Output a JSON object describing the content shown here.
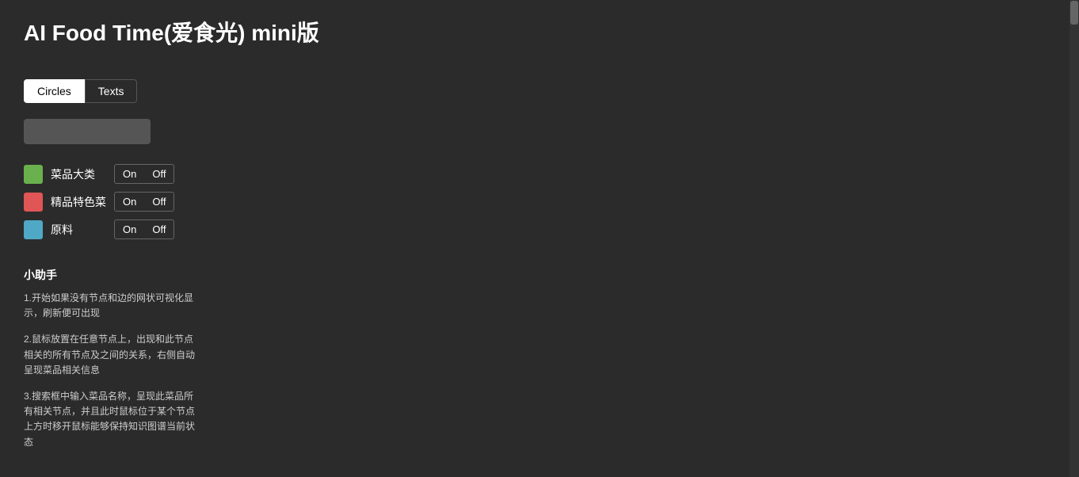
{
  "app": {
    "title": "AI Food Time(爱食光) mini版"
  },
  "tabs": [
    {
      "id": "circles",
      "label": "Circles",
      "active": true
    },
    {
      "id": "texts",
      "label": "Texts",
      "active": false
    }
  ],
  "search": {
    "placeholder": "",
    "value": ""
  },
  "legend": [
    {
      "id": "category",
      "label": "菜品大类",
      "color": "#6ab04c",
      "toggle": {
        "on": "On",
        "off": "Off",
        "state": "on"
      }
    },
    {
      "id": "featured",
      "label": "精品特色菜",
      "color": "#e05555",
      "toggle": {
        "on": "On",
        "off": "Off",
        "state": "on"
      }
    },
    {
      "id": "ingredient",
      "label": "原料",
      "color": "#4fa8c5",
      "toggle": {
        "on": "On",
        "off": "Off",
        "state": "on"
      }
    }
  ],
  "helper": {
    "title": "小助手",
    "items": [
      "1.开始如果没有节点和边的网状可视化显示，刷新便可出现",
      "2.鼠标放置在任意节点上，出现和此节点相关的所有节点及之间的关系，右侧自动呈现菜品相关信息",
      "3.搜索框中输入菜品名称，呈现此菜品所有相关节点，并且此时鼠标位于某个节点上方时移开鼠标能够保持知识图谱当前状态"
    ]
  }
}
